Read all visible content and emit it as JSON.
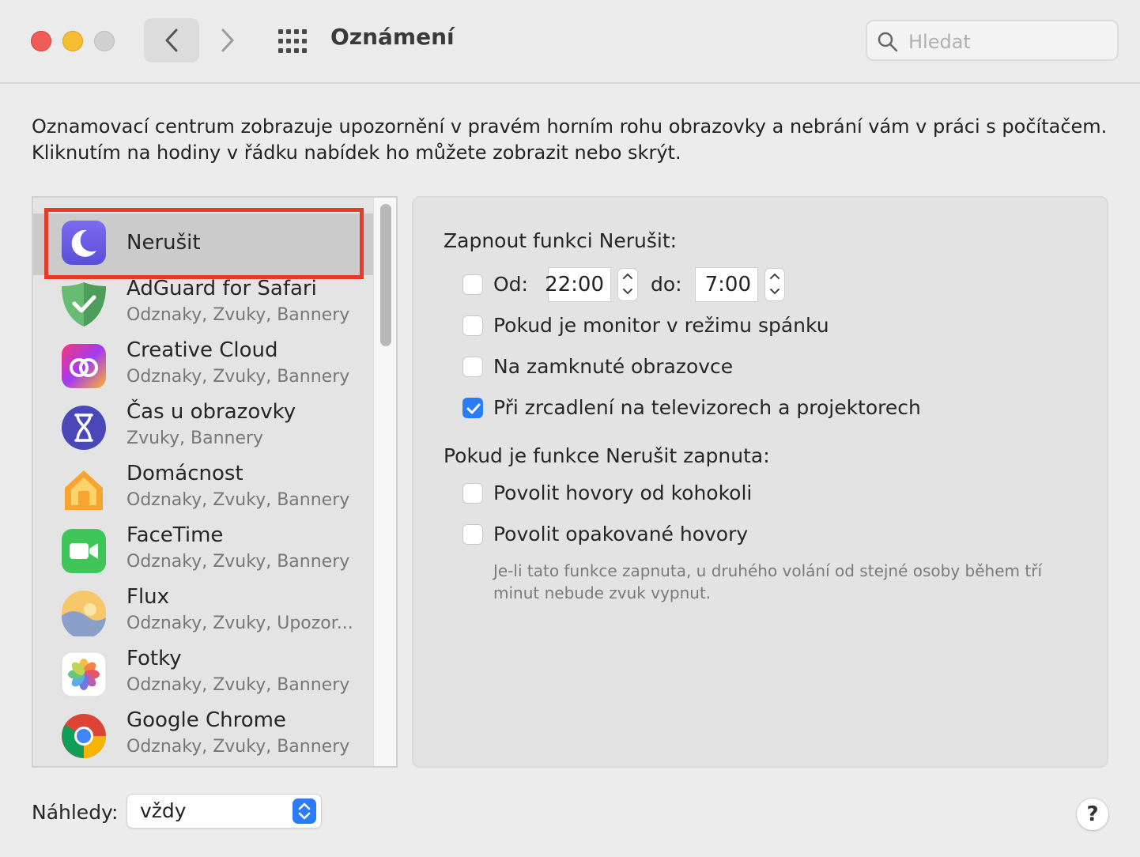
{
  "window": {
    "title": "Oznámení"
  },
  "search": {
    "placeholder": "Hledat"
  },
  "description": "Oznamovací centrum zobrazuje upozornění v pravém horním rohu obrazovky a nebrání vám v práci s počítačem. Kliknutím na hodiny v řádku nabídek ho můžete zobrazit nebo skrýt.",
  "apps": [
    {
      "name": "Nerušit",
      "subtitle": "",
      "icon": "moon-icon",
      "selected": true
    },
    {
      "name": "AdGuard for Safari",
      "subtitle": "Odznaky, Zvuky, Bannery",
      "icon": "adguard-icon"
    },
    {
      "name": "Creative Cloud",
      "subtitle": "Odznaky, Zvuky, Bannery",
      "icon": "creative-cloud-icon"
    },
    {
      "name": "Čas u obrazovky",
      "subtitle": "Zvuky, Bannery",
      "icon": "hourglass-icon"
    },
    {
      "name": "Domácnost",
      "subtitle": "Odznaky, Zvuky, Bannery",
      "icon": "home-icon"
    },
    {
      "name": "FaceTime",
      "subtitle": "Odznaky, Zvuky, Bannery",
      "icon": "facetime-icon"
    },
    {
      "name": "Flux",
      "subtitle": "Odznaky, Zvuky, Upozor...",
      "icon": "flux-icon"
    },
    {
      "name": "Fotky",
      "subtitle": "Odznaky, Zvuky, Bannery",
      "icon": "photos-icon"
    },
    {
      "name": "Google Chrome",
      "subtitle": "Odznaky, Zvuky, Bannery",
      "icon": "chrome-icon"
    }
  ],
  "dnd": {
    "heading": "Zapnout funkci Nerušit:",
    "from_label": "Od:",
    "from_time": "22:00",
    "to_label": "do:",
    "to_time": "7:00",
    "from_checked": false,
    "options": [
      {
        "label": "Pokud je monitor v režimu spánku",
        "checked": false
      },
      {
        "label": "Na zamknuté obrazovce",
        "checked": false
      },
      {
        "label": "Při zrcadlení na televizorech a projektorech",
        "checked": true
      }
    ],
    "when_on_heading": "Pokud je funkce Nerušit zapnuta:",
    "when_on_options": [
      {
        "label": "Povolit hovory od kohokoli",
        "checked": false
      },
      {
        "label": "Povolit opakované hovory",
        "checked": false
      }
    ],
    "note": "Je-li tato funkce zapnuta, u druhého volání od stejné osoby během tří minut nebude zvuk vypnut."
  },
  "previews": {
    "label": "Náhledy:",
    "value": "vždy"
  },
  "help_label": "?",
  "colors": {
    "accent": "#2a7df6",
    "highlight": "#e63a2b"
  }
}
